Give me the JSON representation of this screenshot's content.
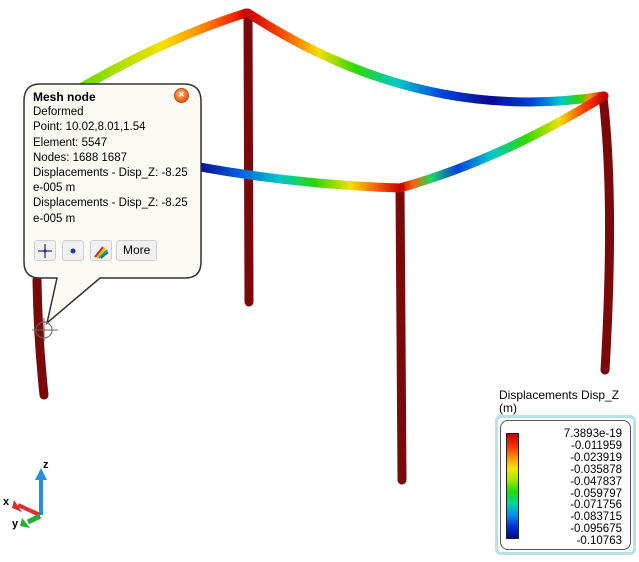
{
  "callout": {
    "title": "Mesh node",
    "lines": [
      "Deformed",
      "Point: 10.02,8.01,1.54",
      "Element: 5547",
      "Nodes: 1688 1687",
      "Displacements - Disp_Z:  -8.25",
      "e-005 m",
      "Displacements - Disp_Z:  -8.25",
      "e-005 m"
    ],
    "close_icon": "close-icon",
    "buttons": [
      {
        "name": "pick-point-button",
        "icon": "crosshair-icon"
      },
      {
        "name": "pick-node-button",
        "icon": "node-dot-icon"
      },
      {
        "name": "result-color-button",
        "icon": "rainbow-icon"
      }
    ],
    "more_label": "More"
  },
  "legend": {
    "title": "Displacements Disp_Z (m)",
    "labels": [
      "7.3893e-19",
      "-0.011959",
      "-0.023919",
      "-0.035878",
      "-0.047837",
      "-0.059797",
      "-0.071756",
      "-0.083715",
      "-0.095675",
      "-0.10763"
    ],
    "colors": [
      "#c40000",
      "#ff2a00",
      "#ff8c00",
      "#f7e600",
      "#9ee800",
      "#1fdc00",
      "#00d8a0",
      "#0090f0",
      "#0030d8",
      "#000a8a"
    ]
  },
  "axes": {
    "x": "x",
    "y": "y",
    "z": "z"
  },
  "colors": {
    "column": "#7a0a0a",
    "axis_z": "#2a8fd8",
    "axis_x": "#d63030",
    "axis_y": "#20b030"
  }
}
